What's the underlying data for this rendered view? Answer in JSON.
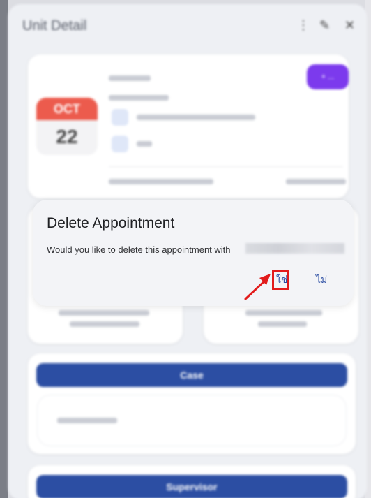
{
  "sheet": {
    "title": "Unit Detail",
    "icons": [
      "more-vertical-icon",
      "pencil-icon",
      "close-icon"
    ]
  },
  "appointment_card": {
    "month": "OCT",
    "day": "22",
    "badge": "+ ..."
  },
  "dialog": {
    "title": "Delete Appointment",
    "message": "Would you like to delete this appointment with",
    "yes_label": "ใช่",
    "no_label": "ไม่"
  },
  "sections": {
    "case_label": "Case",
    "supervisor_label": "Supervisor"
  },
  "colors": {
    "primary": "#2c4ea3",
    "calendar_red": "#ec5b4d",
    "badge_purple": "#7c3aed",
    "highlight_red": "#e21b1b"
  }
}
